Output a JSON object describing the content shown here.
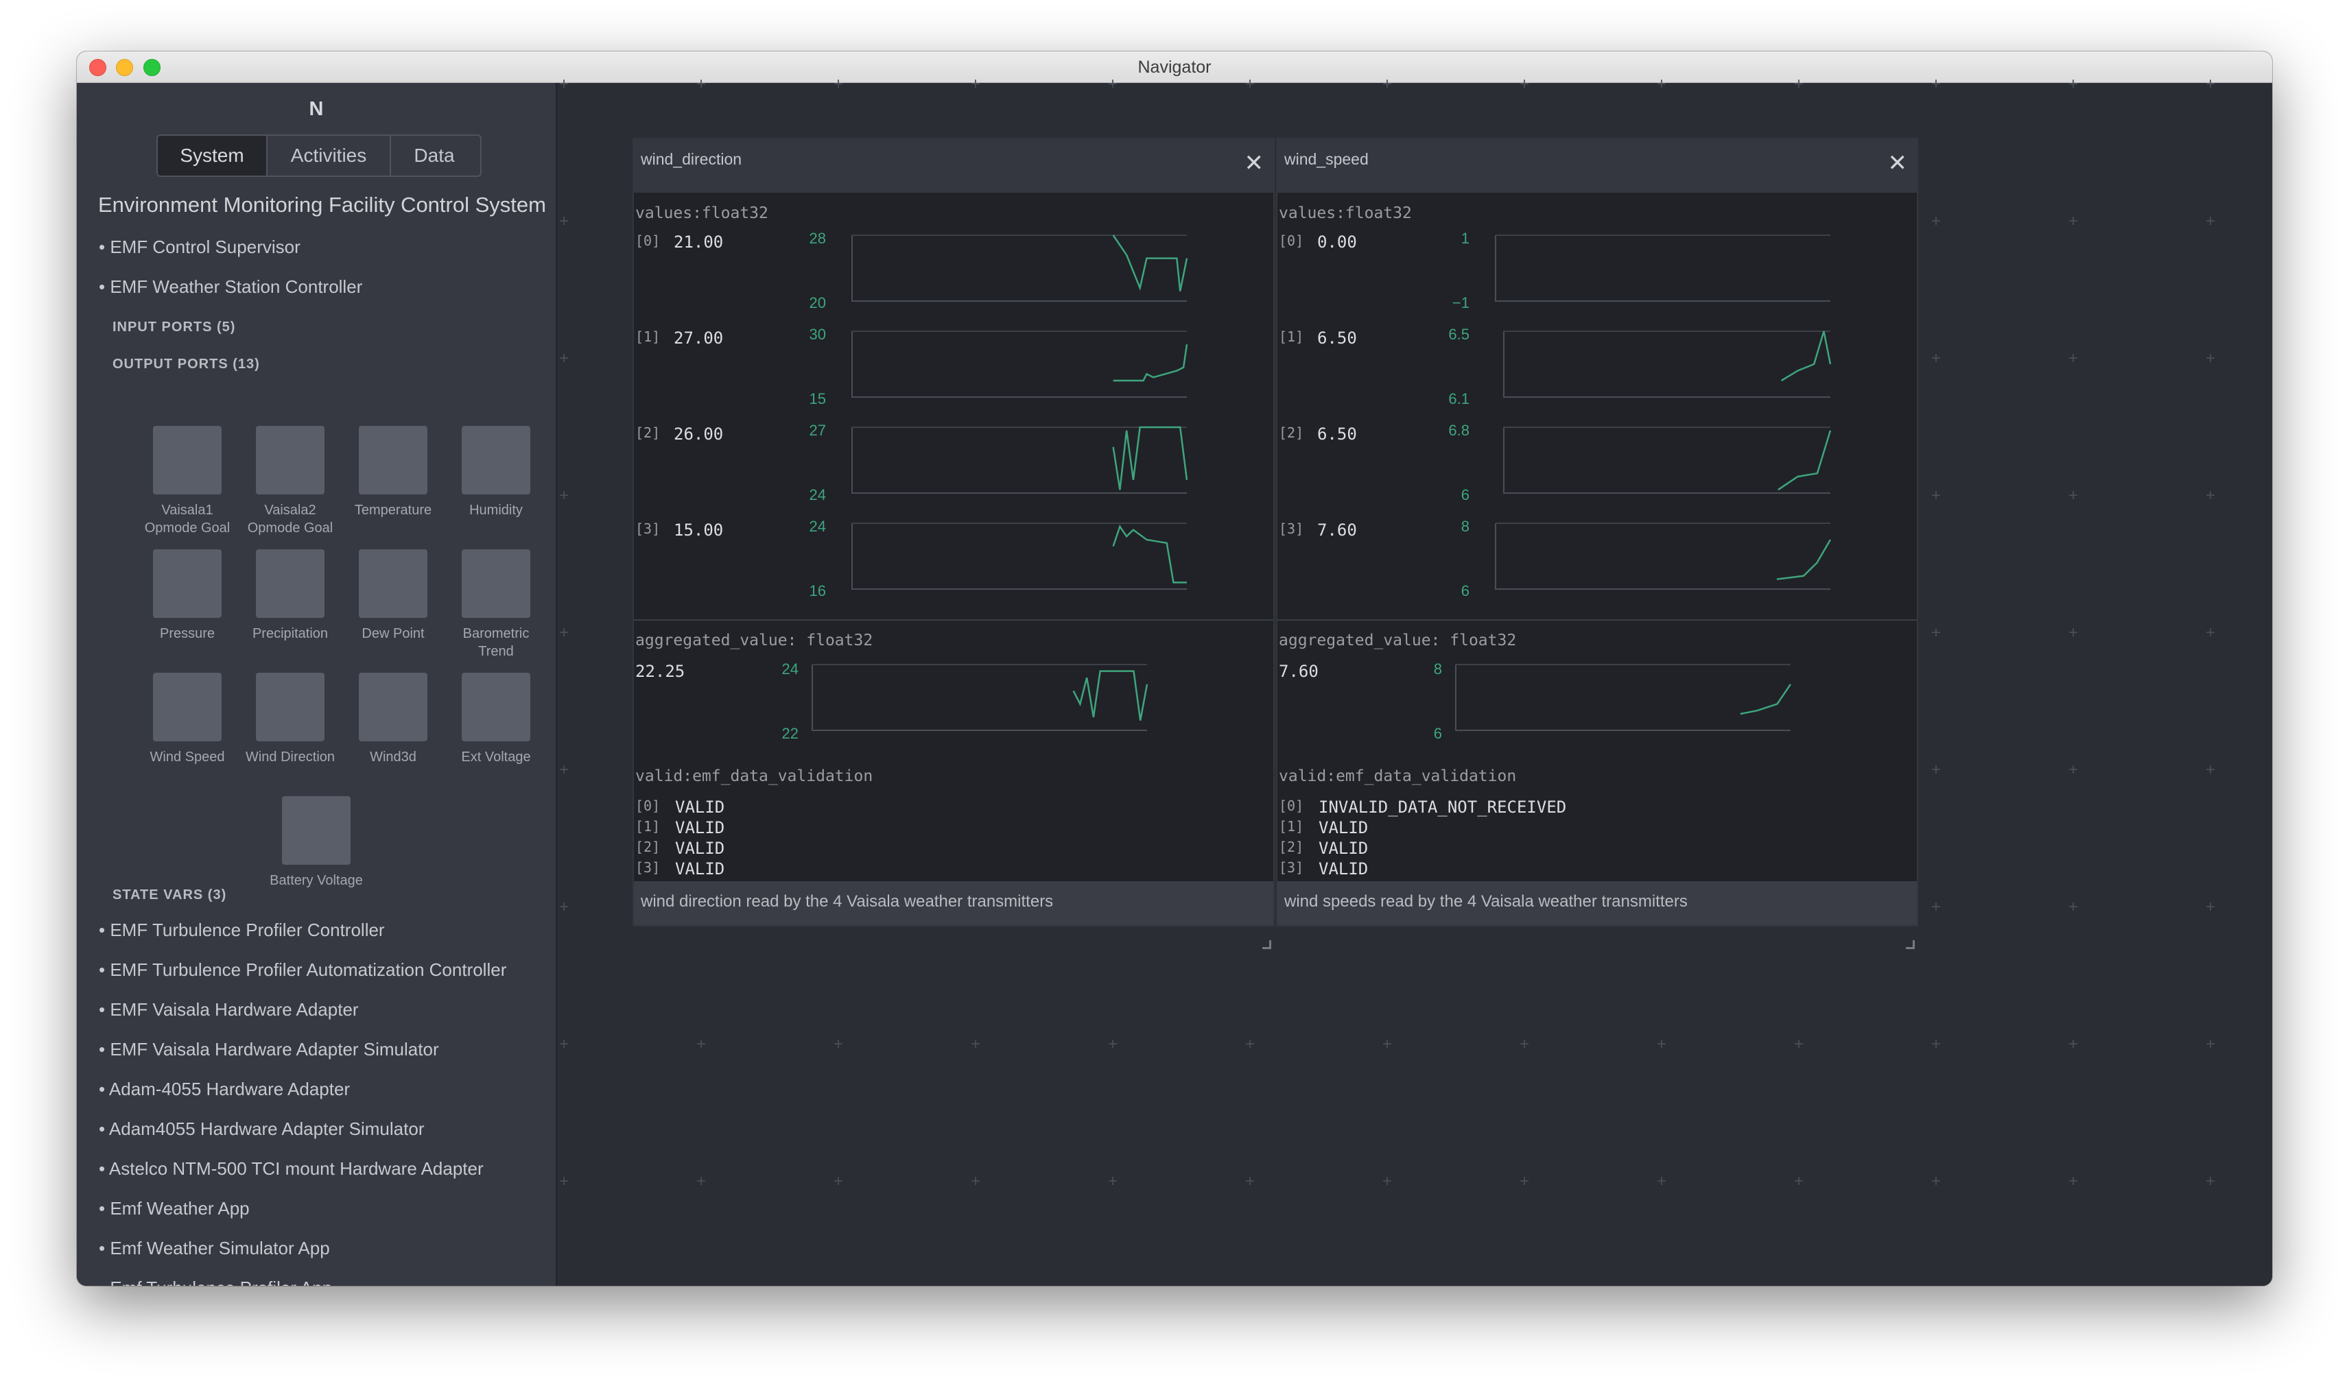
{
  "window": {
    "title": "Navigator"
  },
  "sidebar": {
    "logo": "N",
    "tabs": [
      "System",
      "Activities",
      "Data"
    ],
    "active_tab": "System",
    "system_title": "Environment Monitoring Facility Control System",
    "components_top": [
      "• EMF Control Supervisor",
      "• EMF Weather Station Controller"
    ],
    "input_ports_label": "INPUT PORTS (5)",
    "output_ports_label": "OUTPUT PORTS (13)",
    "output_ports": [
      "Vaisala1 Opmode Goal",
      "Vaisala2 Opmode Goal",
      "Temperature",
      "Humidity",
      "Pressure",
      "Precipitation",
      "Dew Point",
      "Barometric Trend",
      "Wind Speed",
      "Wind Direction",
      "Wind3d",
      "Ext Voltage",
      "Battery Voltage"
    ],
    "state_vars_label": "STATE VARS (3)",
    "components_bottom": [
      "• EMF Turbulence Profiler Controller",
      "• EMF Turbulence Profiler Automatization Controller",
      "• EMF Vaisala Hardware Adapter",
      "• EMF Vaisala Hardware Adapter Simulator",
      "• Adam-4055 Hardware Adapter",
      "• Adam4055 Hardware Adapter Simulator",
      "• Astelco NTM-500 TCI mount Hardware Adapter",
      "• Emf Weather App",
      "• Emf Weather Simulator App",
      "• Emf Turbulence Profiler App"
    ]
  },
  "panels": [
    {
      "title": "wind_direction",
      "close_icon": "close-icon",
      "values_label": "values:float32",
      "values": [
        {
          "index": "[0]",
          "value": "21.00",
          "ymax": "28",
          "ymin": "20"
        },
        {
          "index": "[1]",
          "value": "27.00",
          "ymax": "30",
          "ymin": "15"
        },
        {
          "index": "[2]",
          "value": "26.00",
          "ymax": "27",
          "ymin": "24"
        },
        {
          "index": "[3]",
          "value": "15.00",
          "ymax": "24",
          "ymin": "16"
        }
      ],
      "aggregated_label": "aggregated_value: float32",
      "aggregated": {
        "value": "22.25",
        "ymax": "24",
        "ymin": "22"
      },
      "valid_label": "valid:emf_data_validation",
      "valid": [
        {
          "index": "[0]",
          "value": "VALID"
        },
        {
          "index": "[1]",
          "value": "VALID"
        },
        {
          "index": "[2]",
          "value": "VALID"
        },
        {
          "index": "[3]",
          "value": "VALID"
        }
      ],
      "description": "wind direction read by the 4 Vaisala weather transmitters"
    },
    {
      "title": "wind_speed",
      "close_icon": "close-icon",
      "values_label": "values:float32",
      "values": [
        {
          "index": "[0]",
          "value": "0.00",
          "ymax": "1",
          "ymin": "−1"
        },
        {
          "index": "[1]",
          "value": "6.50",
          "ymax": "6.5",
          "ymin": "6.1"
        },
        {
          "index": "[2]",
          "value": "6.50",
          "ymax": "6.8",
          "ymin": "6"
        },
        {
          "index": "[3]",
          "value": "7.60",
          "ymax": "8",
          "ymin": "6"
        }
      ],
      "aggregated_label": "aggregated_value: float32",
      "aggregated": {
        "value": "7.60",
        "ymax": "8",
        "ymin": "6"
      },
      "valid_label": "valid:emf_data_validation",
      "valid": [
        {
          "index": "[0]",
          "value": "INVALID_DATA_NOT_RECEIVED"
        },
        {
          "index": "[1]",
          "value": "VALID"
        },
        {
          "index": "[2]",
          "value": "VALID"
        },
        {
          "index": "[3]",
          "value": "VALID"
        }
      ],
      "description": "wind speeds read by the 4 Vaisala weather transmitters"
    }
  ],
  "colors": {
    "accent": "#3fa57c",
    "background": "#2a2d34",
    "sidebar": "#363942"
  }
}
